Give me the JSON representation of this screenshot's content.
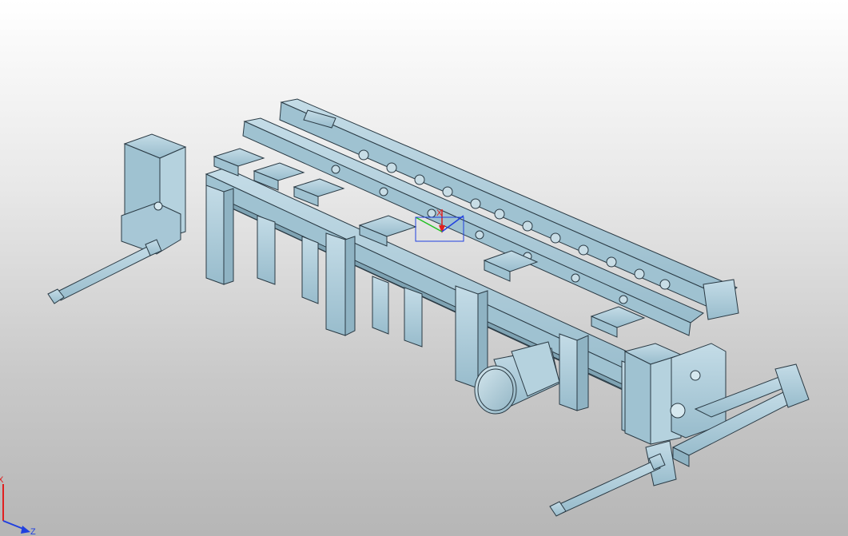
{
  "viewport": {
    "background_top": "#ffffff",
    "background_bottom": "#b6b6b6",
    "model_color": "#a9c9d8",
    "model_edge": "#2a3a44"
  },
  "view_triad": {
    "x_label": "X",
    "z_label": "Z",
    "x_color": "#e02020",
    "y_color": "#20a020",
    "z_color": "#2040e0"
  },
  "origin_triad": {
    "x_label": "X",
    "x_color": "#e02020",
    "y_color": "#20c020",
    "z_color": "#2040e0"
  }
}
